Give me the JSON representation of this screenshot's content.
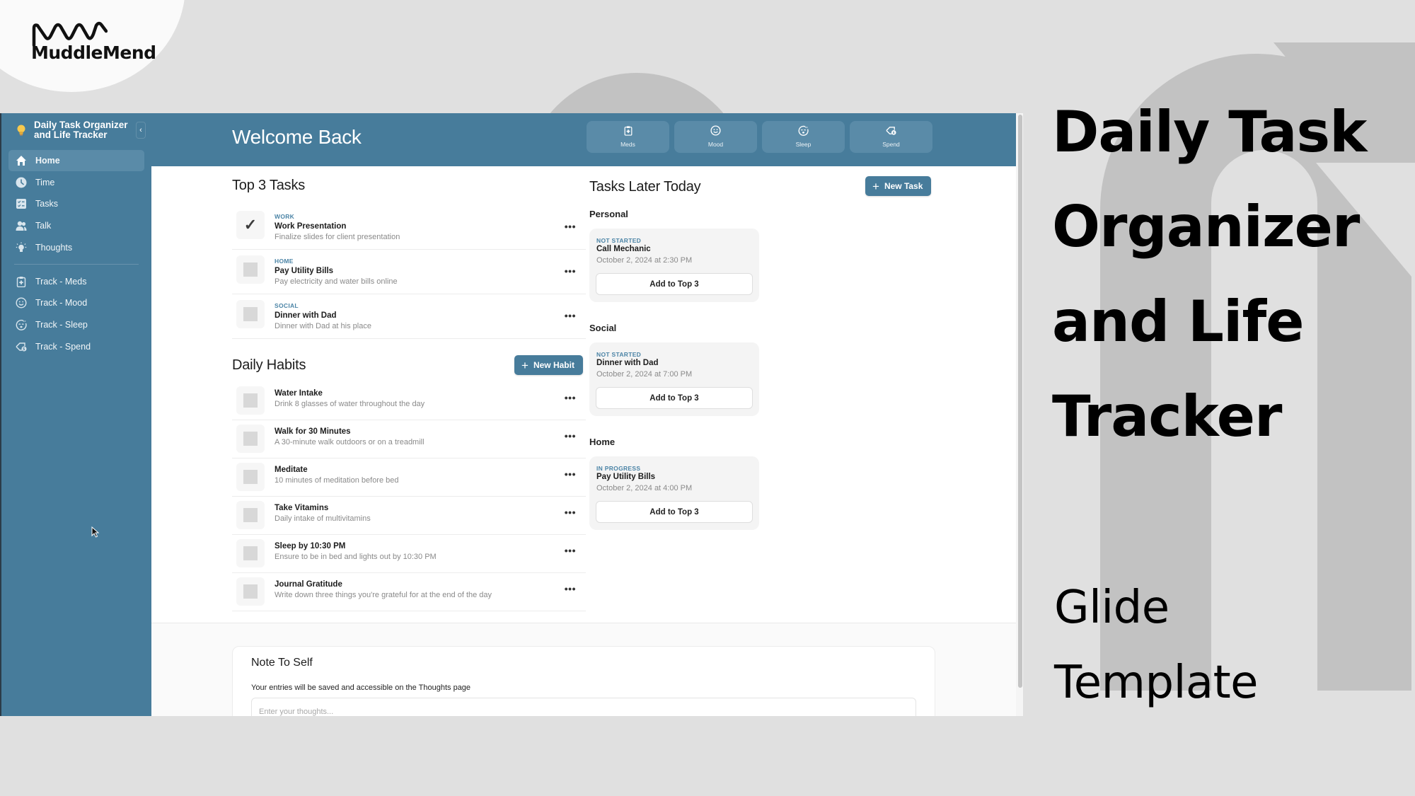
{
  "brand": {
    "logo_text": "MuddleMend"
  },
  "sidebar": {
    "app_title": "Daily Task Organizer and Life Tracker",
    "collapse_icon": "chevron-left",
    "primary_items": [
      {
        "label": "Home",
        "icon": "home-icon",
        "active": true
      },
      {
        "label": "Time",
        "icon": "clock-icon",
        "active": false
      },
      {
        "label": "Tasks",
        "icon": "checklist-icon",
        "active": false
      },
      {
        "label": "Talk",
        "icon": "users-icon",
        "active": false
      },
      {
        "label": "Thoughts",
        "icon": "lightbulb-icon",
        "active": false
      }
    ],
    "tracker_items": [
      {
        "label": "Track - Meds",
        "icon": "clipboard-plus-icon"
      },
      {
        "label": "Track - Mood",
        "icon": "smile-icon"
      },
      {
        "label": "Track - Sleep",
        "icon": "sleep-face-icon"
      },
      {
        "label": "Track - Spend",
        "icon": "price-tag-icon"
      }
    ]
  },
  "header": {
    "title": "Welcome Back",
    "quick_actions": [
      {
        "label": "Meds",
        "icon": "clipboard-plus-icon"
      },
      {
        "label": "Mood",
        "icon": "smile-icon"
      },
      {
        "label": "Sleep",
        "icon": "sleep-face-icon"
      },
      {
        "label": "Spend",
        "icon": "price-tag-icon"
      }
    ]
  },
  "top_tasks": {
    "title": "Top 3 Tasks",
    "items": [
      {
        "category": "WORK",
        "title": "Work Presentation",
        "description": "Finalize slides for client presentation",
        "done": true
      },
      {
        "category": "HOME",
        "title": "Pay Utility Bills",
        "description": "Pay electricity and water bills online",
        "done": false
      },
      {
        "category": "SOCIAL",
        "title": "Dinner with Dad",
        "description": "Dinner with Dad at his place",
        "done": false
      }
    ]
  },
  "daily_habits": {
    "title": "Daily Habits",
    "new_button": "New Habit",
    "items": [
      {
        "title": "Water Intake",
        "description": "Drink 8 glasses of water throughout the day"
      },
      {
        "title": "Walk for 30 Minutes",
        "description": "A 30-minute walk outdoors or on a treadmill"
      },
      {
        "title": "Meditate",
        "description": "10 minutes of meditation before bed"
      },
      {
        "title": "Take Vitamins",
        "description": "Daily intake of multivitamins"
      },
      {
        "title": "Sleep by 10:30 PM",
        "description": "Ensure to be in bed and lights out by 10:30 PM"
      },
      {
        "title": "Journal Gratitude",
        "description": "Write down three things you're grateful for at the end of the day"
      }
    ]
  },
  "tasks_later": {
    "title": "Tasks Later Today",
    "new_button": "New Task",
    "groups": [
      {
        "label": "Personal",
        "status": "NOT STARTED",
        "title": "Call Mechanic",
        "time": "October 2, 2024 at 2:30 PM",
        "action": "Add to Top 3"
      },
      {
        "label": "Social",
        "status": "NOT STARTED",
        "title": "Dinner with Dad",
        "time": "October 2, 2024 at 7:00 PM",
        "action": "Add to Top 3"
      },
      {
        "label": "Home",
        "status": "IN PROGRESS",
        "title": "Pay Utility Bills",
        "time": "October 2, 2024 at 4:00 PM",
        "action": "Add to Top 3"
      }
    ]
  },
  "note_to_self": {
    "title": "Note To Self",
    "subtitle": "Your entries will be saved and accessible on the Thoughts page",
    "placeholder": "Enter your thoughts...",
    "value": ""
  },
  "promo": {
    "title_lines": [
      "Daily Task",
      "Organizer",
      "and Life",
      "Tracker"
    ],
    "subtitle_lines": [
      "Glide",
      "Template"
    ]
  },
  "colors": {
    "accent": "#477c9b",
    "accent_light": "#5a8ba8",
    "category_text": "#4b84a6",
    "background": "#e0e0e0"
  }
}
